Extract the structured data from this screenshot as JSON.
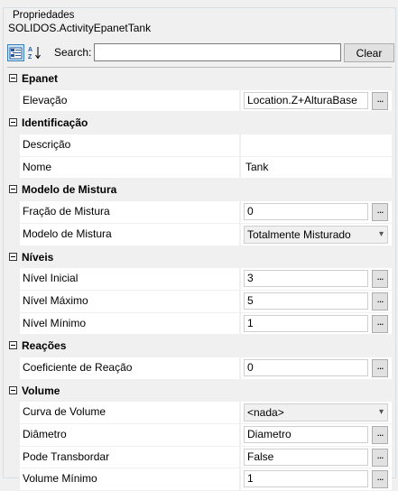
{
  "groupbox": {
    "title": "Propriedades"
  },
  "object_name": "SOLIDOS.ActivityEpanetTank",
  "toolbar": {
    "categorized_icon": "categorized-view-icon",
    "alphabetical_icon": "alphabetical-sort-icon",
    "search_label": "Search:",
    "search_value": "",
    "search_placeholder": "",
    "clear_label": "Clear"
  },
  "grid": {
    "categories": [
      {
        "name": "Epanet",
        "properties": [
          {
            "name": "Elevação",
            "value": "Location.Z+AlturaBase",
            "editor": "ellipsis"
          }
        ]
      },
      {
        "name": "Identificação",
        "properties": [
          {
            "name": "Descrição",
            "value": "",
            "editor": "plain"
          },
          {
            "name": "Nome",
            "value": "Tank",
            "editor": "plain"
          }
        ]
      },
      {
        "name": "Modelo de Mistura",
        "properties": [
          {
            "name": "Fração de Mistura",
            "value": "0",
            "editor": "ellipsis"
          },
          {
            "name": "Modelo de Mistura",
            "value": "Totalmente Misturado",
            "editor": "dropdown"
          }
        ]
      },
      {
        "name": "Níveis",
        "properties": [
          {
            "name": "Nível Inicial",
            "value": "3",
            "editor": "ellipsis"
          },
          {
            "name": "Nível Máximo",
            "value": "5",
            "editor": "ellipsis"
          },
          {
            "name": "Nível Mínimo",
            "value": "1",
            "editor": "ellipsis"
          }
        ]
      },
      {
        "name": "Reações",
        "properties": [
          {
            "name": "Coeficiente de Reação",
            "value": "0",
            "editor": "ellipsis"
          }
        ]
      },
      {
        "name": "Volume",
        "properties": [
          {
            "name": "Curva de Volume",
            "value": "<nada>",
            "editor": "dropdown"
          },
          {
            "name": "Diâmetro",
            "value": "Diametro",
            "editor": "ellipsis"
          },
          {
            "name": "Pode Transbordar",
            "value": "False",
            "editor": "ellipsis"
          },
          {
            "name": "Volume Mínimo",
            "value": "1",
            "editor": "ellipsis"
          }
        ]
      }
    ],
    "ellipsis_label": "...",
    "dropdown_arrow": "▾"
  }
}
